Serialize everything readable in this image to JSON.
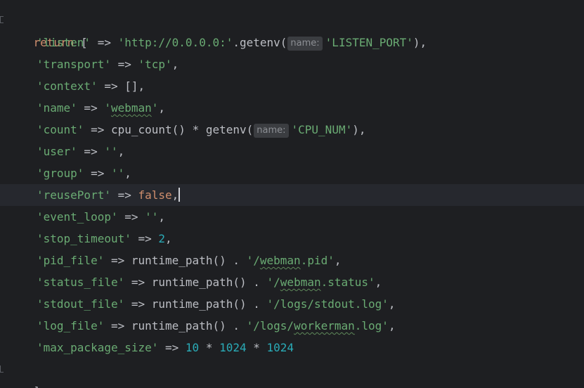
{
  "code": {
    "return_kw": "return",
    "open_bracket": " [",
    "close_bracket": "];",
    "hint_label": "name:",
    "lines": {
      "listen": {
        "key": "'listen'",
        "arrow": " => ",
        "str": "'http://0.0.0.0:'",
        "call": ".getenv(",
        "arg": "'LISTEN_PORT'",
        "tail": "),",
        "tail_cls": "op"
      },
      "transport": {
        "key": "'transport'",
        "arrow": " => ",
        "str": "'tcp'",
        "tail": ","
      },
      "context": {
        "key": "'context'",
        "arrow": " => ",
        "value": "[]",
        "tail": ","
      },
      "name": {
        "key": "'name'",
        "arrow": " => ",
        "q1": "'",
        "word": "webman",
        "q2": "'",
        "tail": ","
      },
      "count": {
        "key": "'count'",
        "arrow": " => ",
        "call1": "cpu_count() * getenv(",
        "arg": "'CPU_NUM'",
        "tail": "),"
      },
      "user": {
        "key": "'user'",
        "arrow": " => ",
        "str": "''",
        "tail": ","
      },
      "group": {
        "key": "'group'",
        "arrow": " => ",
        "str": "''",
        "tail": ","
      },
      "reusePort": {
        "key": "'reusePort'",
        "arrow": " => ",
        "kw": "false",
        "tail": ","
      },
      "event_loop": {
        "key": "'event_loop'",
        "arrow": " => ",
        "str": "''",
        "tail": ","
      },
      "stop_timeout": {
        "key": "'stop_timeout'",
        "arrow": " => ",
        "num": "2",
        "tail": ","
      },
      "pid_file": {
        "key": "'pid_file'",
        "arrow": " => ",
        "call": "runtime_path() . ",
        "s1": "'/",
        "word": "webman",
        "s2": ".pid'",
        "tail": ","
      },
      "status_file": {
        "key": "'status_file'",
        "arrow": " => ",
        "call": "runtime_path() . ",
        "s1": "'/",
        "word": "webman",
        "s2": ".status'",
        "tail": ","
      },
      "stdout_file": {
        "key": "'stdout_file'",
        "arrow": " => ",
        "call": "runtime_path() . ",
        "str": "'/logs/stdout.log'",
        "tail": ","
      },
      "log_file": {
        "key": "'log_file'",
        "arrow": " => ",
        "call": "runtime_path() . ",
        "s1": "'/logs/",
        "word": "workerman",
        "s2": ".log'",
        "tail": ","
      },
      "max_package_size": {
        "key": "'max_package_size'",
        "arrow": " => ",
        "n1": "10",
        "op1": " * ",
        "n2": "1024",
        "op2": " * ",
        "n3": "1024"
      }
    }
  }
}
